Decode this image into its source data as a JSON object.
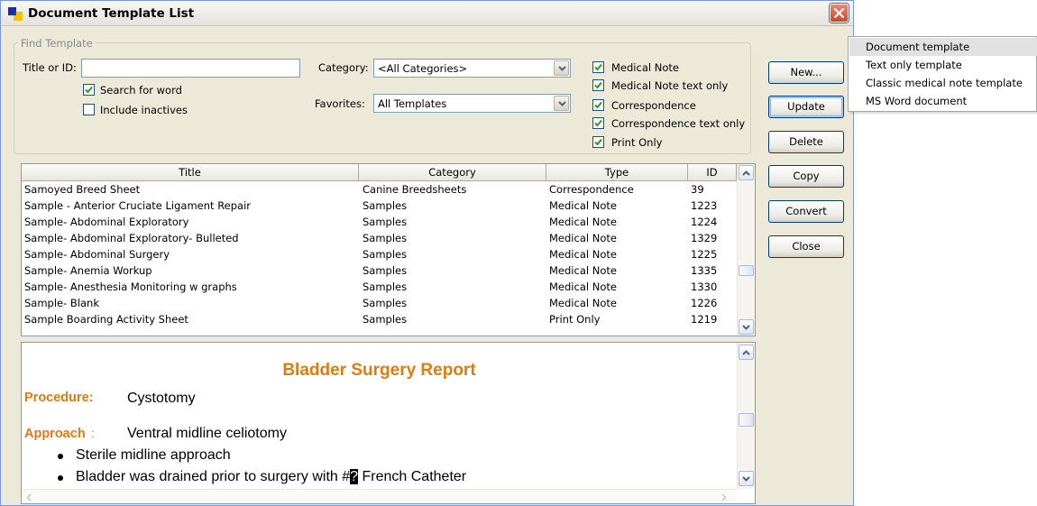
{
  "window": {
    "title": "Document Template List"
  },
  "find": {
    "legend": "Find Template",
    "title_label": "Title or ID:",
    "title_value": "",
    "search_for_word": {
      "label": "Search for word",
      "checked": true
    },
    "include_inactives": {
      "label": "Include inactives",
      "checked": false
    },
    "category_label": "Category:",
    "category_value": "<All Categories>",
    "favorites_label": "Favorites:",
    "favorites_value": "All Templates",
    "type_filters": [
      {
        "label": "Medical Note",
        "checked": true
      },
      {
        "label": "Medical Note text only",
        "checked": true
      },
      {
        "label": "Correspondence",
        "checked": true
      },
      {
        "label": "Correspondence text only",
        "checked": true
      },
      {
        "label": "Print Only",
        "checked": true
      }
    ]
  },
  "buttons": {
    "new": "New...",
    "update": "Update",
    "delete": "Delete",
    "copy": "Copy",
    "convert": "Convert",
    "close": "Close"
  },
  "grid": {
    "columns": [
      "Title",
      "Category",
      "Type",
      "ID"
    ],
    "rows": [
      [
        "Samoyed Breed Sheet",
        "Canine Breedsheets",
        "Correspondence",
        "39"
      ],
      [
        "Sample - Anterior Cruciate Ligament Repair",
        "Samples",
        "Medical Note",
        "1223"
      ],
      [
        "Sample- Abdominal Exploratory",
        "Samples",
        "Medical Note",
        "1224"
      ],
      [
        "Sample- Abdominal Exploratory- Bulleted",
        "Samples",
        "Medical Note",
        "1329"
      ],
      [
        "Sample- Abdominal Surgery",
        "Samples",
        "Medical Note",
        "1225"
      ],
      [
        "Sample- Anemia Workup",
        "Samples",
        "Medical Note",
        "1335"
      ],
      [
        "Sample- Anesthesia Monitoring w graphs",
        "Samples",
        "Medical Note",
        "1330"
      ],
      [
        "Sample- Blank",
        "Samples",
        "Medical Note",
        "1226"
      ],
      [
        "Sample Boarding Activity Sheet",
        "Samples",
        "Print Only",
        "1219"
      ]
    ]
  },
  "preview": {
    "title": "Bladder Surgery Report",
    "procedure_label": "Procedure:",
    "procedure_value": "Cystotomy",
    "approach_label": "Approach",
    "approach_colon": ":",
    "approach_value": "Ventral midline celiotomy",
    "bullet_1": "Sterile midline approach",
    "bullet_2_before": "Bladder was drained prior to surgery with #",
    "bullet_2_cursor": "?",
    "bullet_2_after": " French Catheter"
  },
  "new_menu": {
    "items": [
      "Document template",
      "Text only template",
      "Classic medical note template",
      "MS Word document"
    ],
    "highlighted_index": 0
  },
  "colors": {
    "accent_orange": "#e07b10",
    "menu_highlight": "#e1e1e1",
    "window_bg": "#ece9d8"
  }
}
